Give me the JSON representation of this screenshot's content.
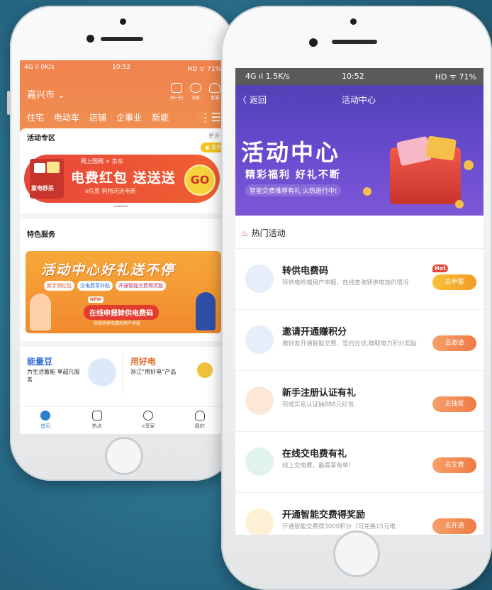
{
  "left_phone": {
    "status": {
      "signal": "4G ıl 0K/s",
      "time": "10:52",
      "right": "HD ᯤ 71%"
    },
    "city": "嘉兴市",
    "top_icons": [
      {
        "label": "扫一扫",
        "icon": "scan-icon"
      },
      {
        "label": "消息",
        "icon": "message-icon"
      },
      {
        "label": "客服",
        "icon": "headset-icon"
      }
    ],
    "categories": [
      "住宅",
      "电动车",
      "店铺",
      "企事业",
      "新能"
    ],
    "activity": {
      "title": "活动专区",
      "more": "更多",
      "sign_label": "签到",
      "banner": {
        "left_tag": "家电秒杀",
        "partners": "网上国网 × 京东",
        "headline": "电费红包 送送送",
        "sub": "e信惠 购物还送电费",
        "go": "GO"
      }
    },
    "featured": {
      "title": "特色服务",
      "banner": {
        "headline": "活动中心好礼送不停",
        "chips": [
          "新手领红包",
          "交电费享补贴",
          "开通智能交费得奖励"
        ],
        "new": "NEW",
        "cta": "在线申报转供电费码",
        "cta_sub": "仅限转供电费码用户申报"
      }
    },
    "cards": [
      {
        "title": "能量豆",
        "desc": "为生活蓄能 享超凡服务"
      },
      {
        "title": "用好电",
        "desc": "浙江“用好电”产品"
      }
    ],
    "tabbar": [
      {
        "label": "首页",
        "icon": "home-icon"
      },
      {
        "label": "热点",
        "icon": "news-icon"
      },
      {
        "label": "e享家",
        "icon": "leaf-icon"
      },
      {
        "label": "我的",
        "icon": "user-icon"
      }
    ]
  },
  "right_phone": {
    "status": {
      "signal": "4G ıl 1.5K/s",
      "time": "10:52",
      "right": "HD ᯤ 71%"
    },
    "back": "返回",
    "title": "活动中心",
    "hero": {
      "headline": "活动中心",
      "sub": "精彩福利 好礼不断",
      "tag": "智能交费推荐有礼 火热进行中!"
    },
    "hot_title": "热门活动",
    "activities": [
      {
        "title": "转供电费码",
        "desc": "转供电终端用户申报，在线查询转供电加价情况",
        "button": "去申报",
        "hot": "Hot"
      },
      {
        "title": "邀请开通赚积分",
        "desc": "邀好友开通智能交费、签约光伏,赚取电力积分奖励",
        "button": "去邀请"
      },
      {
        "title": "新手注册认证有礼",
        "desc": "完成实名认证抽888元红包",
        "button": "去抽奖"
      },
      {
        "title": "在线交电费有礼",
        "desc": "线上交电费，最高享免单!",
        "button": "去交费"
      },
      {
        "title": "开通智能交费得奖励",
        "desc": "开通智能交费得3000积分（可兑换15元电",
        "button": "去开通"
      }
    ]
  }
}
